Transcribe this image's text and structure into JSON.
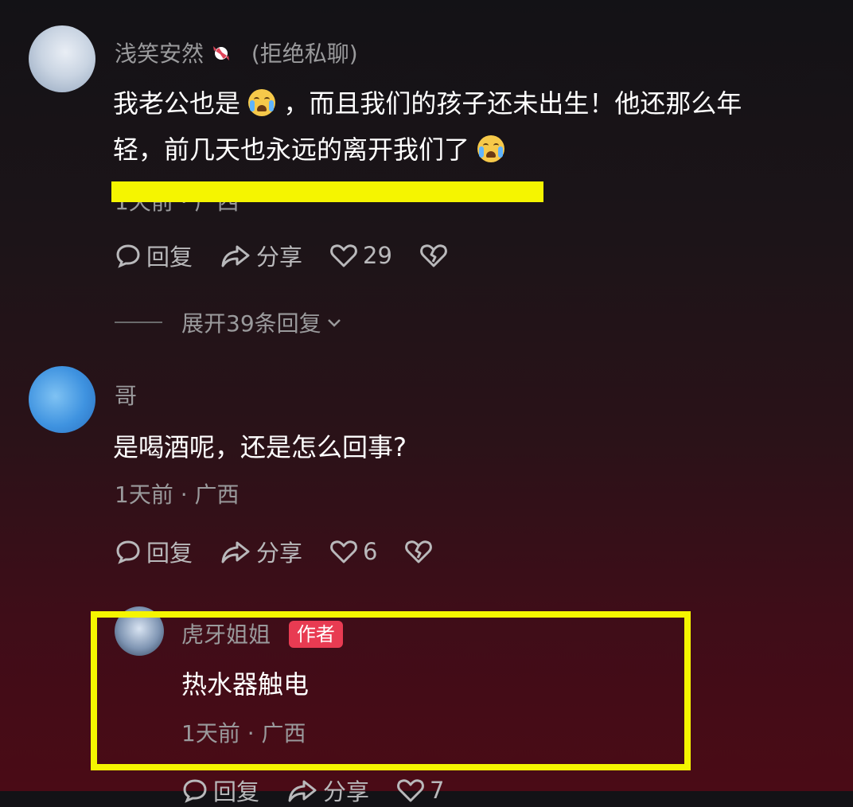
{
  "comments": [
    {
      "username": "浅笑安然",
      "username_suffix": "(拒绝私聊)",
      "line1_a": "我老公也是",
      "line1_b": "，而且我们的孩子还未出生！他还那么年",
      "line2": "轻，前几天也永远的离开我们了",
      "meta": "1天前 · 广西",
      "reply_label": "回复",
      "share_label": "分享",
      "like_count": "29",
      "expand_label": "展开39条回复"
    },
    {
      "username": "哥",
      "text": "是喝酒呢，还是怎么回事?",
      "meta": "1天前 · 广西",
      "reply_label": "回复",
      "share_label": "分享",
      "like_count": "6"
    },
    {
      "username": "虎牙姐姐",
      "author_badge": "作者",
      "text": "热水器触电",
      "meta": "1天前 · 广西",
      "reply_label": "回复",
      "share_label": "分享",
      "like_count": "7"
    }
  ],
  "colors": {
    "highlight": "#f5f500",
    "badge": "#e83b52"
  },
  "icons": [
    "reply-bubble-icon",
    "share-arrow-icon",
    "heart-icon",
    "broken-heart-icon",
    "crying-emoji-icon",
    "candy-icon",
    "chevron-down-icon"
  ]
}
